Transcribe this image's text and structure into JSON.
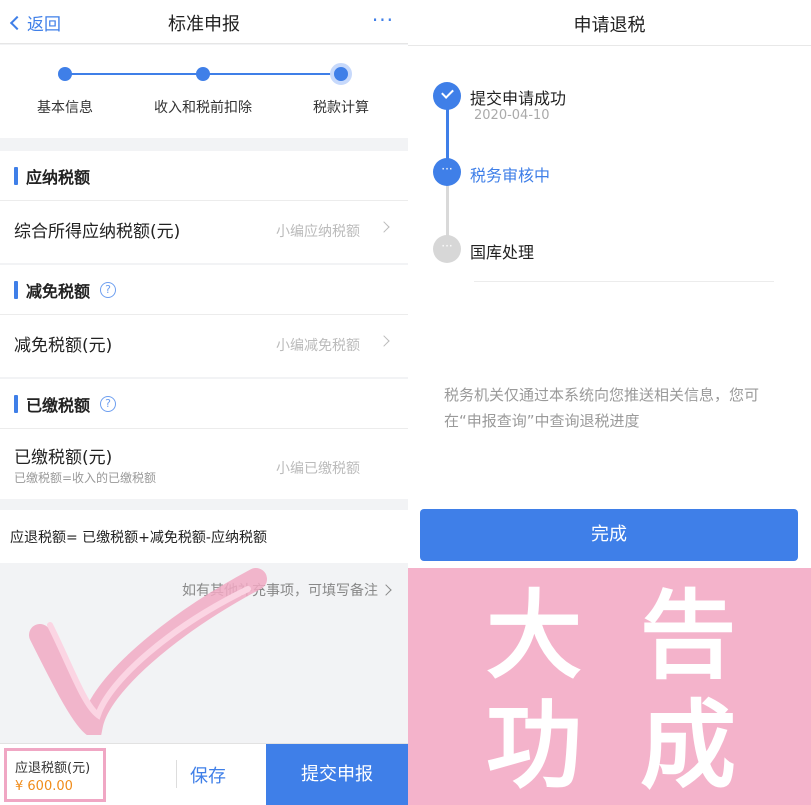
{
  "left": {
    "nav": {
      "back": "返回",
      "title": "标准申报",
      "more": "···"
    },
    "steps": [
      "基本信息",
      "收入和税前扣除",
      "税款计算"
    ],
    "sections": {
      "payable": {
        "title": "应纳税额",
        "row_label": "综合所得应纳税额(元)",
        "row_value": "小编应纳税额"
      },
      "relief": {
        "title": "减免税额",
        "row_label": "减免税额(元)",
        "row_value": "小编减免税额"
      },
      "paid": {
        "title": "已缴税额",
        "row_label": "已缴税额(元)",
        "row_sub": "已缴税额=收入的已缴税额",
        "row_value": "小编已缴税额"
      }
    },
    "formula": "应退税额= 已缴税额+减免税额-应纳税额",
    "note": "如有其他补充事项，可填写备注",
    "bottom": {
      "refund_label": "应退税额(元)",
      "refund_value": "¥ 600.00",
      "save": "保存",
      "submit": "提交申报"
    }
  },
  "right": {
    "title": "申请退税",
    "timeline": [
      {
        "label": "提交申请成功",
        "date": "2020-04-10",
        "state": "done"
      },
      {
        "label": "税务审核中",
        "state": "doing"
      },
      {
        "label": "国库处理",
        "state": "todo"
      }
    ],
    "info": "税务机关仅通过本系统向您推送相关信息，您可在“申报查询”中查询退税进度",
    "done_button": "完成",
    "banner": [
      "大",
      "告",
      "功",
      "成"
    ]
  },
  "colors": {
    "accent": "#3f7fe8",
    "highlight_pink": "#f4b3cb",
    "amount_orange": "#f08c1a"
  }
}
